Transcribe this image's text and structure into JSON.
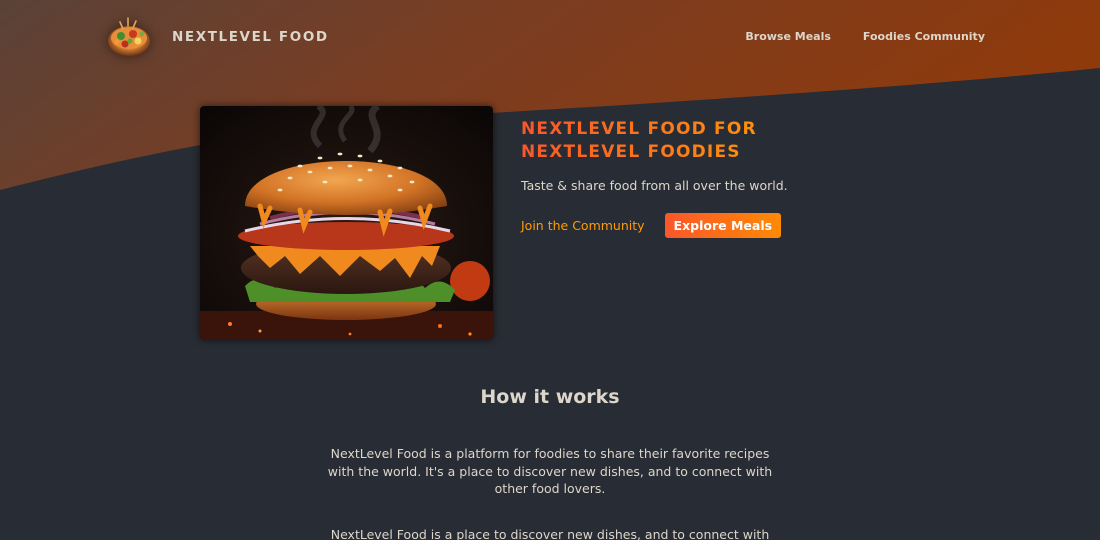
{
  "header": {
    "logo_text": "NextLevel Food",
    "nav": [
      {
        "label": "Browse Meals"
      },
      {
        "label": "Foodies Community"
      }
    ]
  },
  "hero": {
    "title": "NextLevel Food for NextLevel Foodies",
    "tagline": "Taste & share food from all over the world.",
    "join_label": "Join the Community",
    "explore_label": "Explore Meals"
  },
  "how": {
    "title": "How it works",
    "paragraphs": [
      "NextLevel Food is a platform for foodies to share their favorite recipes with the world. It's a place to discover new dishes, and to connect with other food lovers.",
      "NextLevel Food is a place to discover new dishes, and to connect with"
    ]
  },
  "colors": {
    "background": "#282c34",
    "text": "#ddd6cb",
    "accent_start": "#f9572a",
    "accent_end": "#ff9b05",
    "header_brown": "#6b3f2e",
    "header_orange": "#8c3d0f"
  },
  "icons": {
    "logo": "food-bowl-logo",
    "hero": "burger-image"
  }
}
